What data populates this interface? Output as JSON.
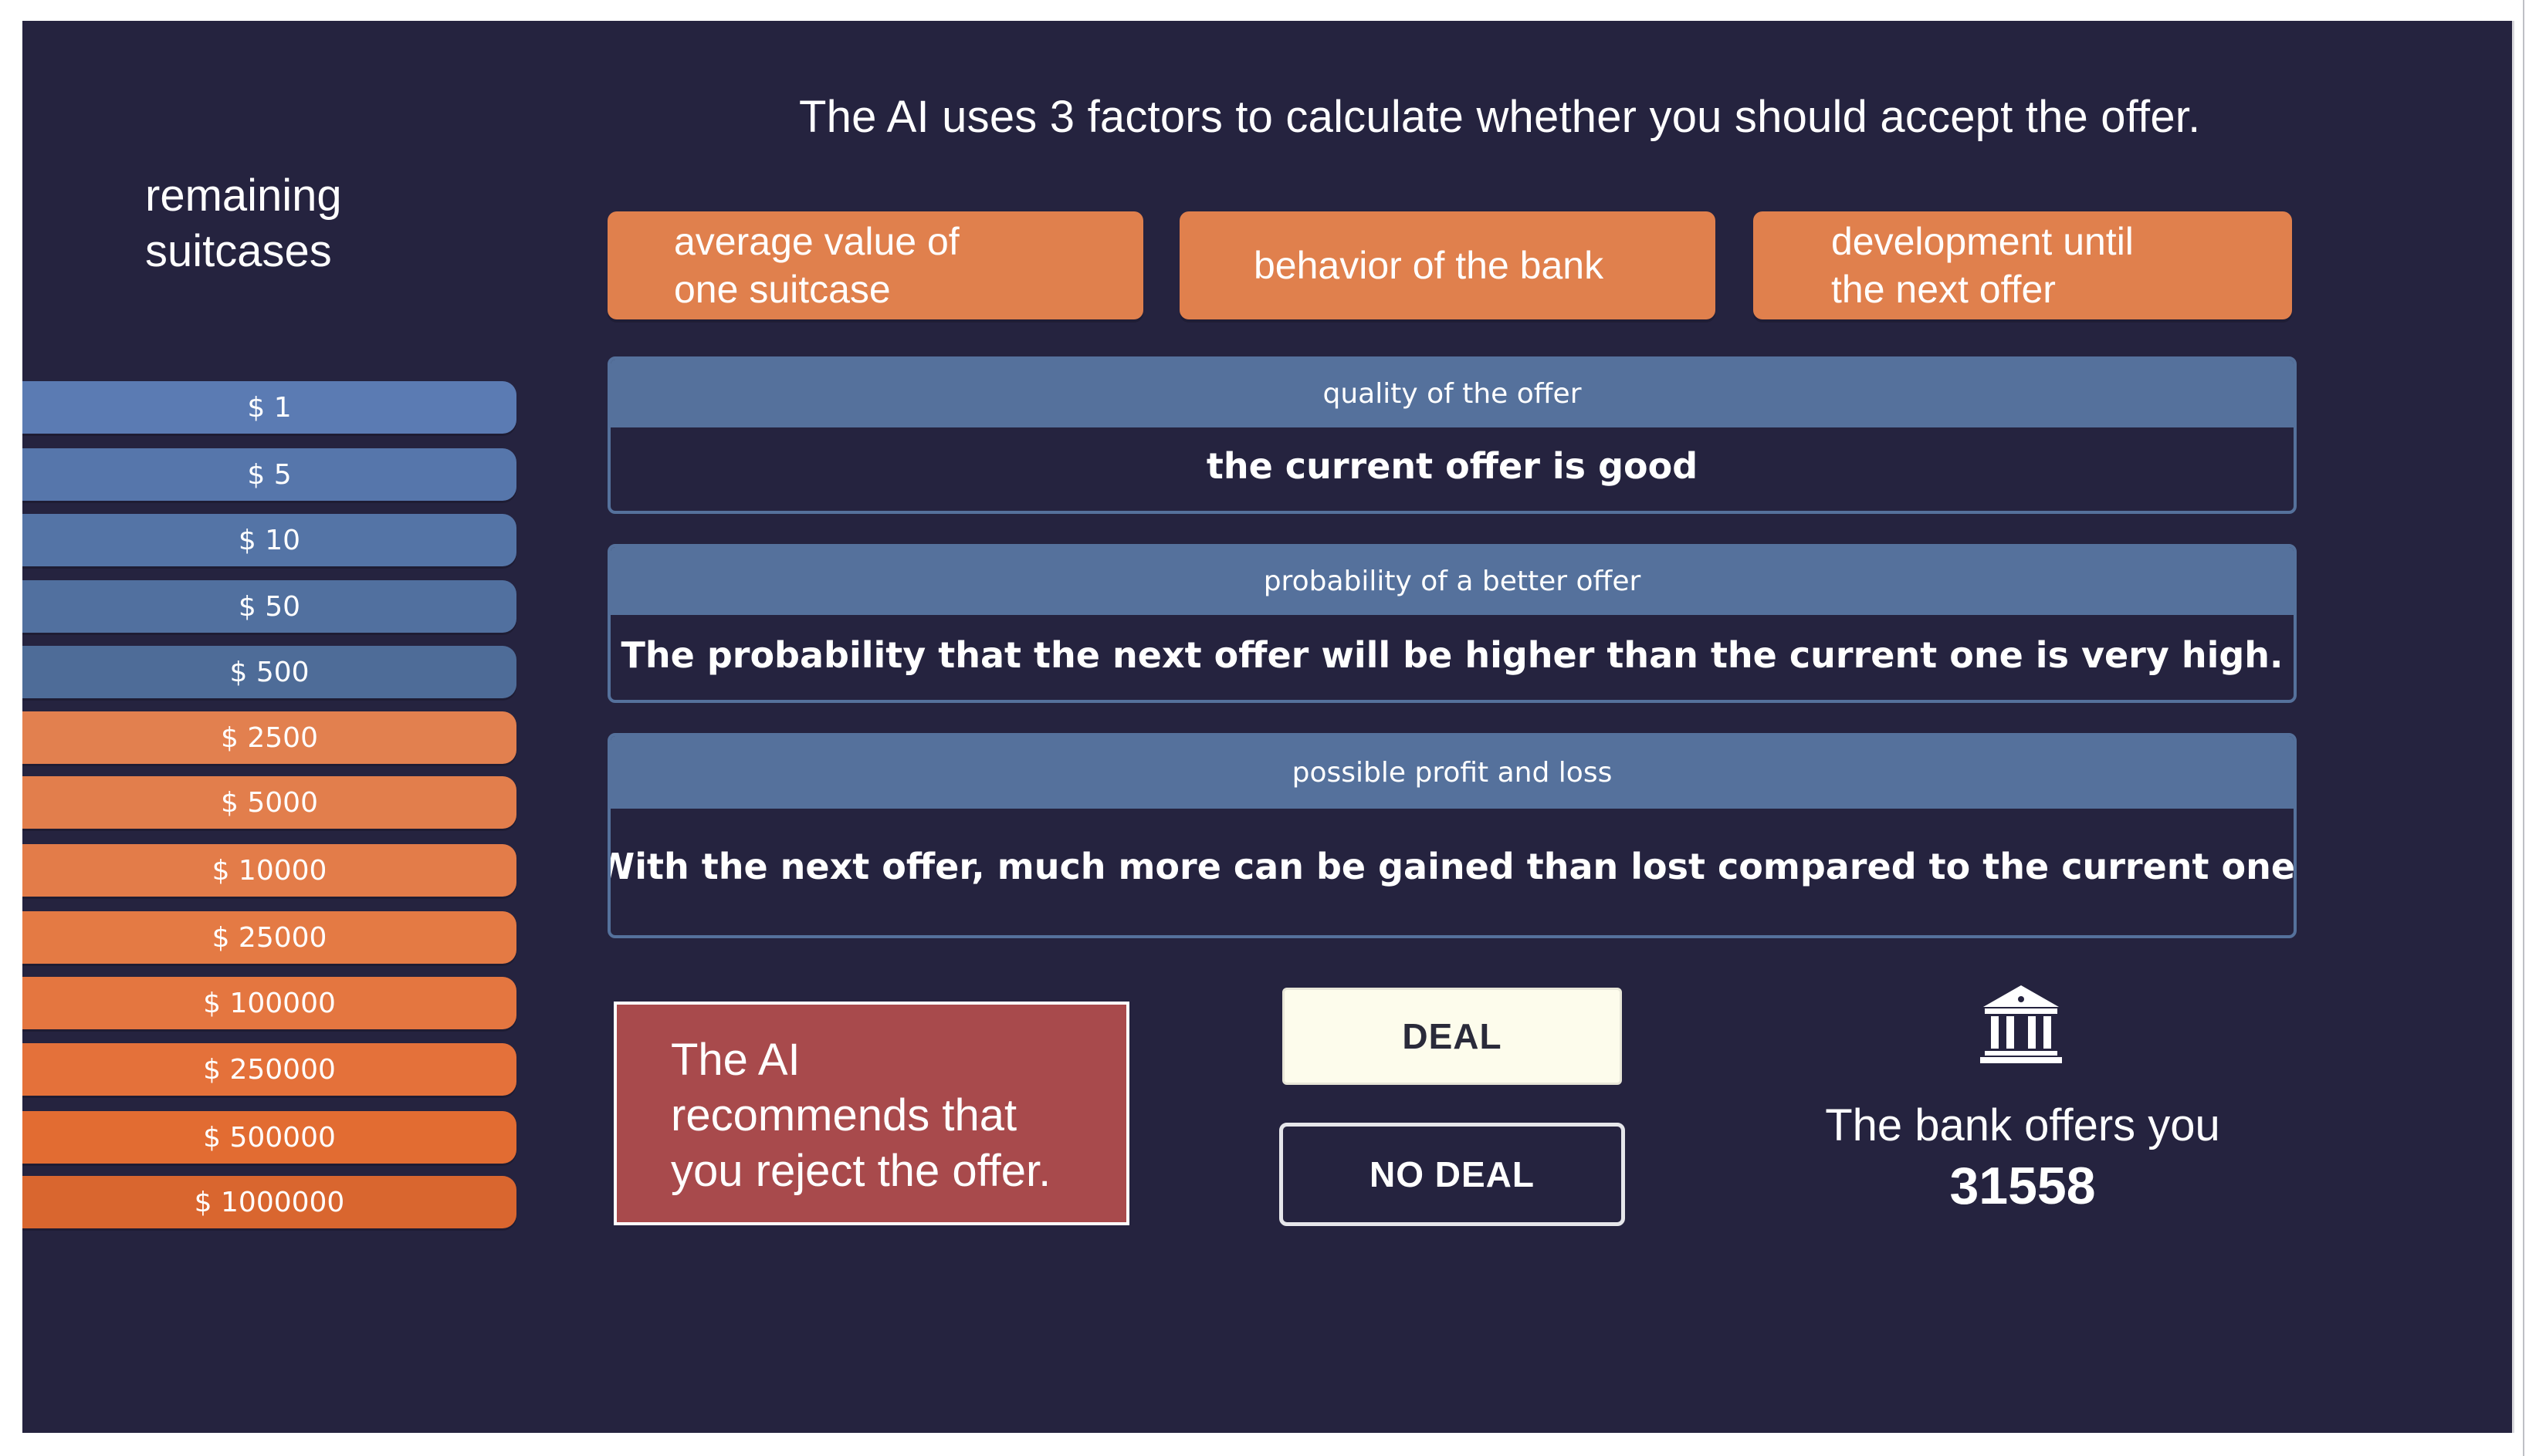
{
  "headline": "The AI uses 3 factors to calculate whether you should accept the offer.",
  "sidebar": {
    "title": "remaining\nsuitcases",
    "cases": [
      {
        "label": "$ 1",
        "color": "#5b7bb3"
      },
      {
        "label": "$ 5",
        "color": "#5676ab"
      },
      {
        "label": "$ 10",
        "color": "#5474a6"
      },
      {
        "label": "$ 50",
        "color": "#51709f"
      },
      {
        "label": "$ 500",
        "color": "#4e6c98"
      },
      {
        "label": "$ 2500",
        "color": "#e2804f"
      },
      {
        "label": "$ 5000",
        "color": "#e27e4c"
      },
      {
        "label": "$ 10000",
        "color": "#e37c49"
      },
      {
        "label": "$ 25000",
        "color": "#e47a44"
      },
      {
        "label": "$ 100000",
        "color": "#e47640"
      },
      {
        "label": "$ 250000",
        "color": "#e4713a"
      },
      {
        "label": "$ 500000",
        "color": "#e26c32"
      },
      {
        "label": "$ 1000000",
        "color": "#d9662f"
      }
    ]
  },
  "factors": [
    {
      "label": "average value of\none suitcase"
    },
    {
      "label": "behavior of the bank"
    },
    {
      "label": "development until\nthe next offer"
    }
  ],
  "sections": [
    {
      "header": "quality of the offer",
      "text": "the current offer is good"
    },
    {
      "header": "probability of a better offer",
      "text": "The probability that the next offer will be higher than the current one is very high."
    },
    {
      "header": "possible profit and loss",
      "text": "With the next offer, much more can be gained than lost compared to the current one."
    }
  ],
  "recommendation": {
    "text": "The AI\nrecommends that\nyou reject the offer."
  },
  "buttons": {
    "deal": "DEAL",
    "no_deal": "NO DEAL"
  },
  "bank": {
    "icon": "bank-icon",
    "text": "The bank offers you",
    "amount": "31558"
  },
  "colors": {
    "background": "#25233f",
    "accent_orange": "#e0804d",
    "accent_blue": "#55719c",
    "recommendation_red": "#a84a4c"
  }
}
